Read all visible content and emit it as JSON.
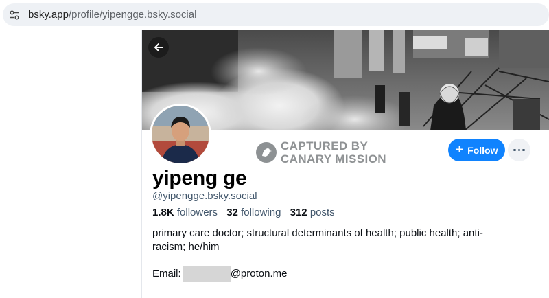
{
  "browser": {
    "url_host": "bsky.app",
    "url_path": "/profile/yipengge.bsky.social"
  },
  "watermark": {
    "line1": "CAPTURED BY",
    "line2": "CANARY MISSION"
  },
  "actions": {
    "follow_label": "Follow",
    "more_icon": "more-horizontal-icon"
  },
  "profile": {
    "display_name": "yipeng ge",
    "handle": "@yipengge.bsky.social",
    "followers_count": "1.8K",
    "followers_label": "followers",
    "following_count": "32",
    "following_label": "following",
    "posts_count": "312",
    "posts_label": "posts",
    "bio": "primary care doctor; structural determinants of health; public health; anti-racism; he/him",
    "email_label": "Email:",
    "email_domain": "@proton.me"
  },
  "colors": {
    "accent": "#1083fe",
    "muted_text": "#42576c"
  }
}
